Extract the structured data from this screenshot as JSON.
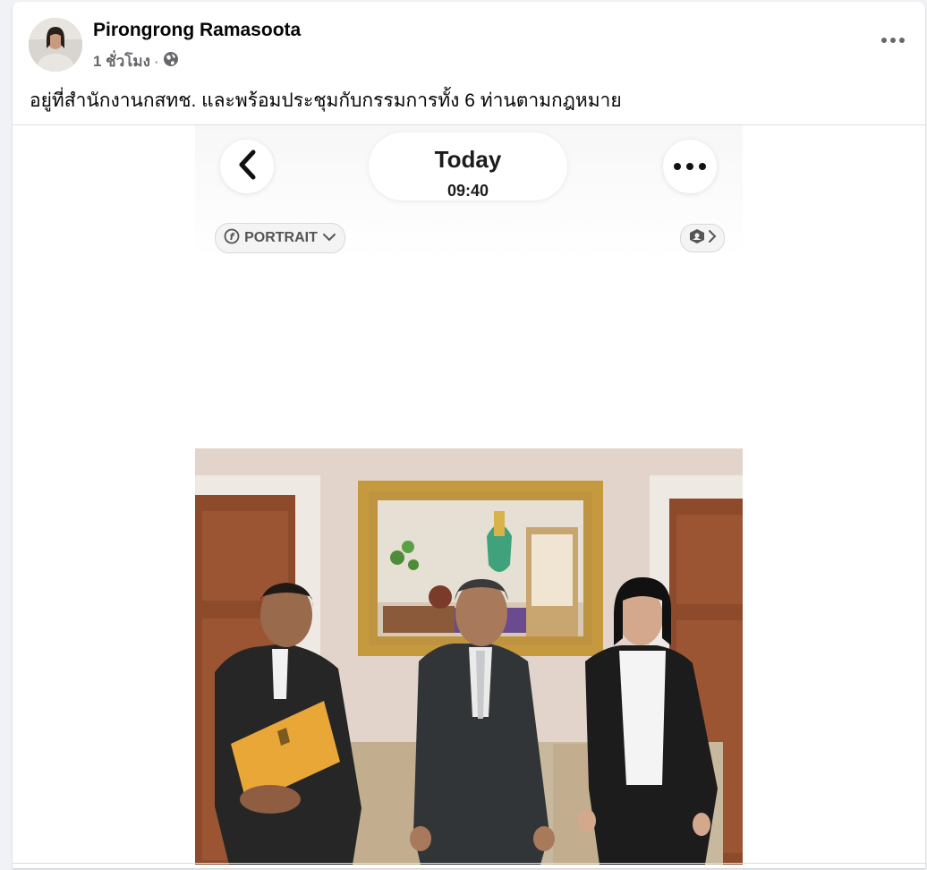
{
  "post": {
    "author": "Pirongrong Ramasoota",
    "time": "1 ชั่วโมง",
    "separator": "·",
    "caption": "อยู่ที่สำนักงานกสทช. และพร้อมประชุมกับกรรมการทั้ง 6 ท่านตามกฎหมาย"
  },
  "photo": {
    "date_title": "Today",
    "date_time": "09:40",
    "portrait_label": "PORTRAIT"
  },
  "icons": {
    "privacy": "globe-icon",
    "menu": "more-horizontal-icon",
    "back": "chevron-left-icon",
    "photo_menu": "more-horizontal-icon",
    "portrait": "aperture-icon",
    "dropdown": "chevron-down-icon",
    "edit": "image-edit-icon"
  },
  "colors": {
    "background": "#f0f2f5",
    "card": "#ffffff",
    "text_primary": "#050505",
    "text_secondary": "#65676b"
  }
}
